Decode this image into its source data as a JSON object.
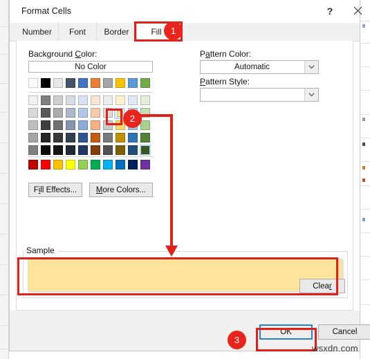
{
  "window": {
    "title": "Format Cells",
    "help_icon": "question-mark-icon",
    "close_icon": "close-icon"
  },
  "tabs": [
    {
      "label": "Number",
      "active": false
    },
    {
      "label": "Font",
      "active": false
    },
    {
      "label": "Border",
      "active": false
    },
    {
      "label": "Fill",
      "active": true
    }
  ],
  "fill_tab": {
    "background_color_label": "Background Color:",
    "no_color_label": "No Color",
    "pattern_color_label": "Pattern Color:",
    "pattern_color_value": "Automatic",
    "pattern_style_label": "Pattern Style:",
    "pattern_style_value": "",
    "fill_effects_label": "Fill Effects...",
    "more_colors_label": "More Colors...",
    "clear_label": "Clear",
    "sample_legend": "Sample",
    "sample_fill_color": "#fde49a",
    "dropdown_icon": "chevron-down-icon"
  },
  "palette": {
    "theme_row": [
      "#ffffff",
      "#000000",
      "#e7e6e6",
      "#44546a",
      "#4472c4",
      "#ed7d31",
      "#a5a5a5",
      "#ffc000",
      "#5b9bd5",
      "#70ad47"
    ],
    "tint_rows": [
      [
        "#f2f2f2",
        "#7f7f7f",
        "#d0cece",
        "#d6dce4",
        "#d9e2f3",
        "#fbe5d6",
        "#ededed",
        "#fff2cc",
        "#deebf7",
        "#e2efd9"
      ],
      [
        "#d8d8d8",
        "#595959",
        "#aeaaaa",
        "#adb9ca",
        "#b4c7e7",
        "#f7cbac",
        "#dbdbdb",
        "#ffe699",
        "#bdd7ee",
        "#c5e0b4"
      ],
      [
        "#bfbfbf",
        "#3f3f3f",
        "#757070",
        "#8496b0",
        "#8eaadb",
        "#f4b183",
        "#c9c9c9",
        "#ffd966",
        "#9dc3e6",
        "#a9d18e"
      ],
      [
        "#a5a5a5",
        "#262626",
        "#3a3838",
        "#333f50",
        "#2f5597",
        "#c55a11",
        "#7b7b7b",
        "#bf8f00",
        "#2e75b6",
        "#538135"
      ],
      [
        "#7f7f7f",
        "#0c0c0c",
        "#171616",
        "#222a35",
        "#1f3864",
        "#833c0c",
        "#525252",
        "#7f6000",
        "#1f4e79",
        "#375623"
      ]
    ],
    "standard_row": [
      "#c00000",
      "#ff0000",
      "#ffc000",
      "#ffff00",
      "#92d050",
      "#00b050",
      "#00b0f0",
      "#0070c0",
      "#002060",
      "#7030a0"
    ],
    "selected_swatch_color": "#ffe699",
    "selected_swatch_row": 1,
    "selected_swatch_col": 7,
    "focus_swatch_color": "#538135",
    "focus_swatch_row": 4,
    "focus_swatch_col": 9
  },
  "footer": {
    "ok_label": "OK",
    "cancel_label": "Cancel"
  },
  "annotations": {
    "markers": [
      {
        "number": "1",
        "target": "Fill tab"
      },
      {
        "number": "2",
        "target": "light yellow color swatch"
      },
      {
        "number": "3",
        "target": "OK button"
      }
    ],
    "accent_color": "#e0211a"
  },
  "watermark": "wsxdn.com"
}
